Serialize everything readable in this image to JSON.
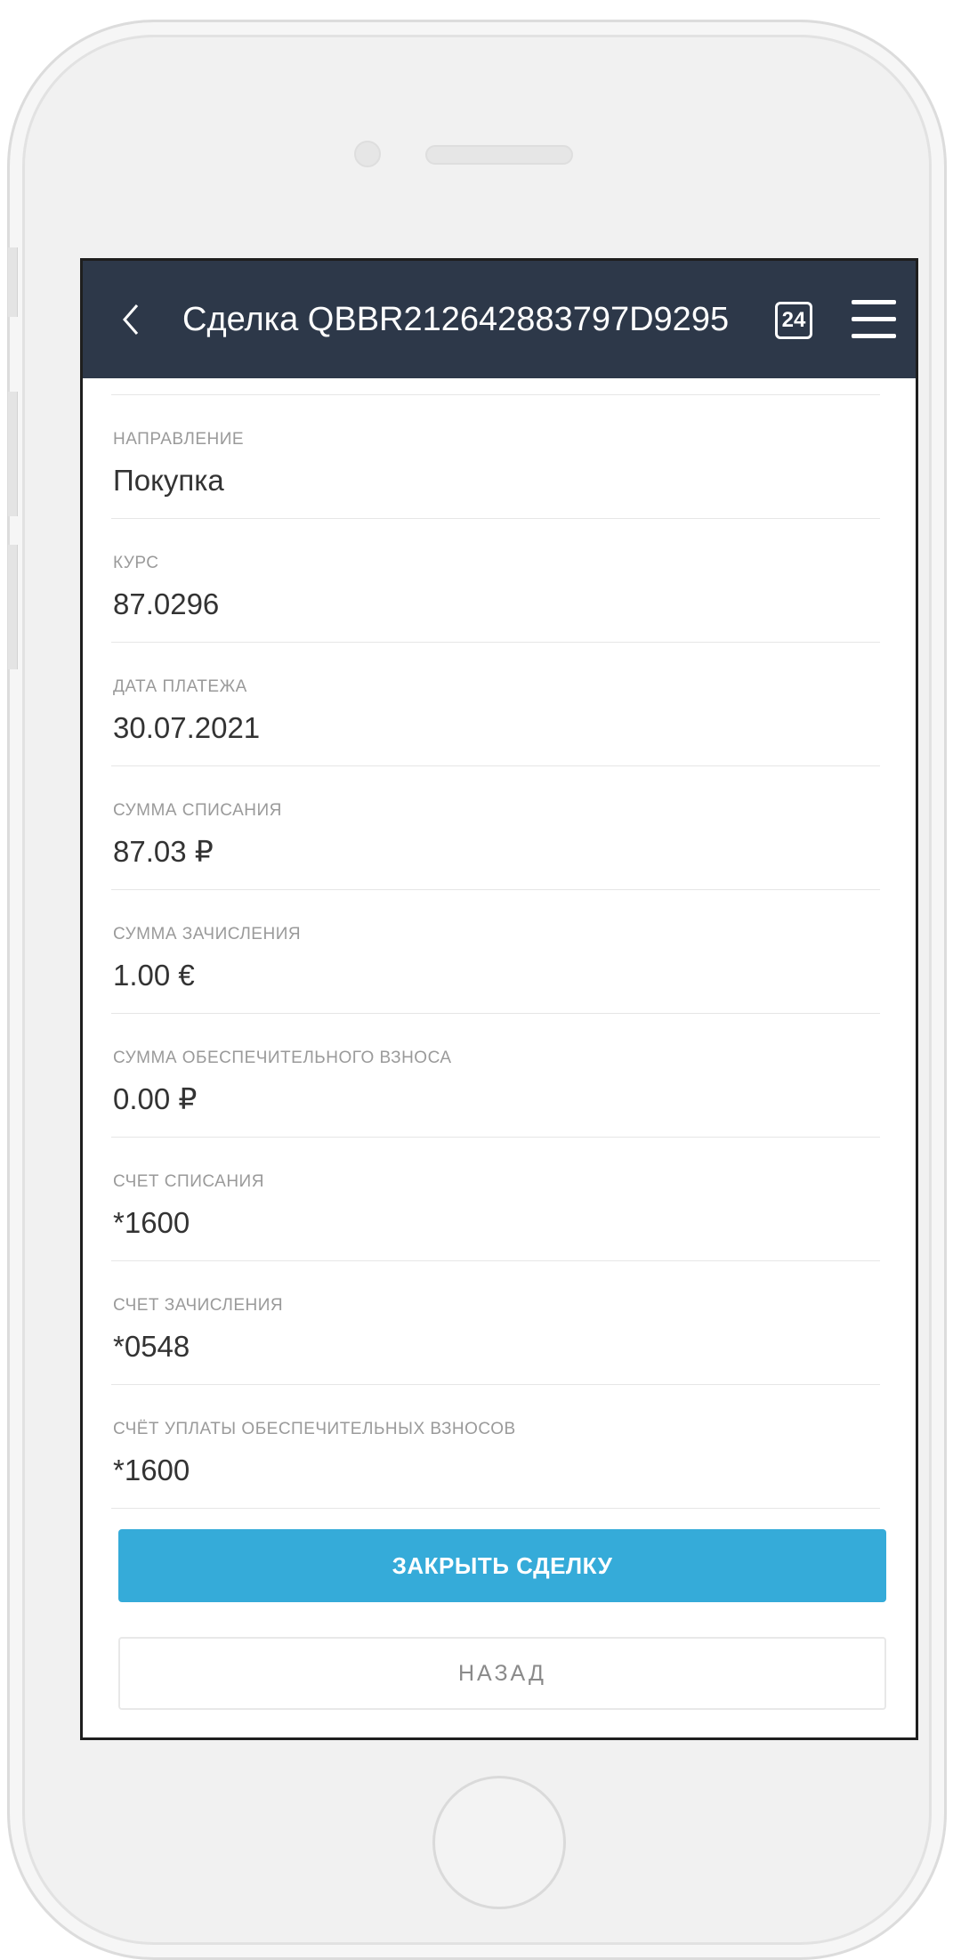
{
  "header": {
    "title": "Сделка QBBR212642883797D9295",
    "badge": "24",
    "back_icon": "chevron-left-icon",
    "menu_icon": "hamburger-menu-icon",
    "background_color": "#2d3849"
  },
  "fields": [
    {
      "label": "НАПРАВЛЕНИЕ",
      "value": "Покупка"
    },
    {
      "label": "КУРС",
      "value": "87.0296"
    },
    {
      "label": "ДАТА ПЛАТЕЖА",
      "value": "30.07.2021"
    },
    {
      "label": "СУММА СПИСАНИЯ",
      "value": "87.03 ₽"
    },
    {
      "label": "СУММА ЗАЧИСЛЕНИЯ",
      "value": "1.00 €"
    },
    {
      "label": "СУММА ОБЕСПЕЧИТЕЛЬНОГО ВЗНОСА",
      "value": "0.00 ₽"
    },
    {
      "label": "СЧЕТ СПИСАНИЯ",
      "value": "*1600"
    },
    {
      "label": "СЧЕТ ЗАЧИСЛЕНИЯ",
      "value": "*0548"
    },
    {
      "label": "СЧЁТ УПЛАТЫ ОБЕСПЕЧИТЕЛЬНЫХ ВЗНОСОВ",
      "value": "*1600"
    }
  ],
  "actions": {
    "close_deal_label": "ЗАКРЫТЬ СДЕЛКУ",
    "back_label": "НАЗАД",
    "accent_color": "#35abd9"
  }
}
